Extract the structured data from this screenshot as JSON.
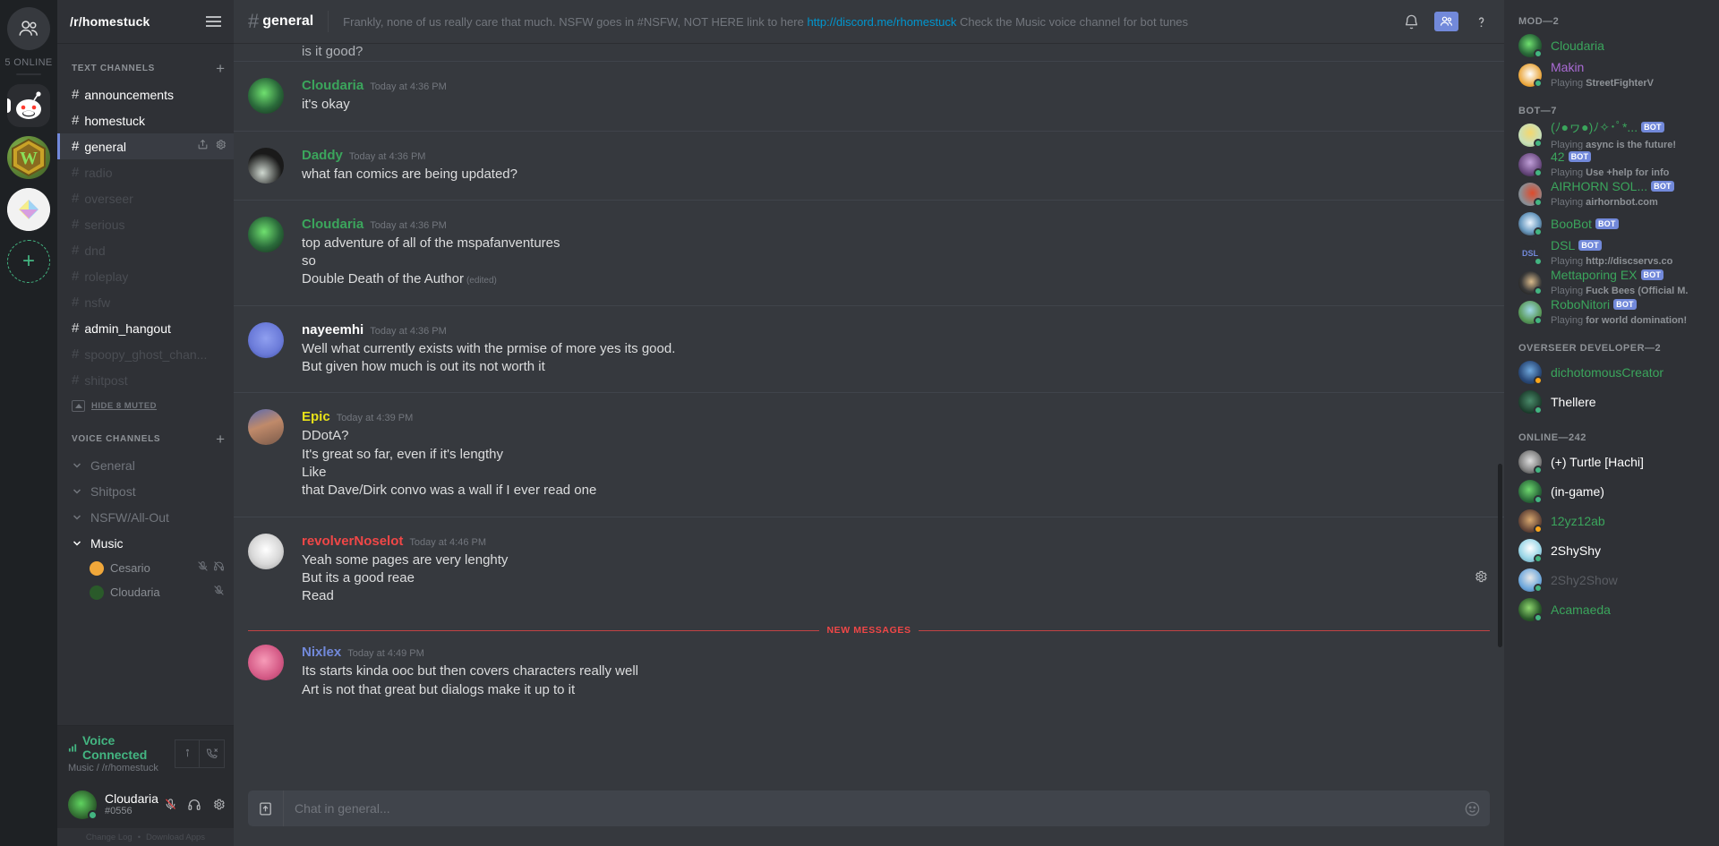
{
  "guild_rail": {
    "home_icon": "friends-icon",
    "online_label": "5 ONLINE",
    "add_label": "+",
    "servers": [
      {
        "name": "reddit-server",
        "colors": [
          "#2b2d31",
          "#ffffff"
        ]
      },
      {
        "name": "warcraft-server",
        "colors": [
          "#4a6b2a",
          "#c6e36a"
        ]
      },
      {
        "name": "pastel-server",
        "colors": [
          "#f0f0f0",
          "#f5e87a"
        ]
      }
    ]
  },
  "sidebar": {
    "guild_name": "/r/homestuck",
    "text_header": "TEXT CHANNELS",
    "voice_header": "VOICE CHANNELS",
    "add_channel": "+",
    "text_channels": [
      {
        "name": "announcements",
        "state": "unread"
      },
      {
        "name": "homestuck",
        "state": "unread"
      },
      {
        "name": "general",
        "state": "active"
      },
      {
        "name": "radio",
        "state": "muted"
      },
      {
        "name": "overseer",
        "state": "muted"
      },
      {
        "name": "serious",
        "state": "muted"
      },
      {
        "name": "dnd",
        "state": "muted"
      },
      {
        "name": "roleplay",
        "state": "muted"
      },
      {
        "name": "nsfw",
        "state": "muted"
      },
      {
        "name": "admin_hangout",
        "state": "unread"
      },
      {
        "name": "spoopy_ghost_chan...",
        "state": "muted"
      },
      {
        "name": "shitpost",
        "state": "muted"
      }
    ],
    "hide_muted_label": "HIDE 8 MUTED",
    "voice_channels": [
      {
        "name": "General",
        "selected": false,
        "users": []
      },
      {
        "name": "Shitpost",
        "selected": false,
        "users": []
      },
      {
        "name": "NSFW/All-Out",
        "selected": false,
        "users": []
      },
      {
        "name": "Music",
        "selected": true,
        "users": [
          {
            "name": "Cesario",
            "color": "#f0a73a"
          },
          {
            "name": "Cloudaria",
            "color": "#3a7a3a"
          }
        ]
      }
    ],
    "voice_panel": {
      "status": "Voice Connected",
      "location": "Music / /r/homestuck",
      "info_icon": "info-icon",
      "disconnect_icon": "phone-hangup-icon"
    },
    "user": {
      "name": "Cloudaria",
      "tag": "#0556",
      "mute_icon": "mic-muted-icon",
      "deafen_icon": "headphones-icon",
      "settings_icon": "gear-icon"
    },
    "footer": {
      "changelog": "Change Log",
      "separator": "•",
      "download": "Download Apps"
    }
  },
  "channel_header": {
    "hash": "#",
    "name": "general",
    "topic_pre": "Frankly, none of us really care that much. NSFW goes in #NSFW, NOT HERE link to here ",
    "topic_link": "http://discord.me/rhomestuck",
    "topic_post": " Check the Music voice channel for bot tunes",
    "bell_icon": "bell-icon",
    "members_icon": "members-icon",
    "help_icon": "help-icon"
  },
  "messages": {
    "partial_top": "is it good?",
    "new_messages_label": "NEW MESSAGES",
    "list": [
      {
        "user": "Cloudaria",
        "color": "#3ba55c",
        "time": "Today at 4:36 PM",
        "avatar": "cloudaria-avatar",
        "lines": [
          "it's okay"
        ]
      },
      {
        "user": "Daddy",
        "color": "#3ba55c",
        "time": "Today at 4:36 PM",
        "avatar": "daddy-avatar",
        "lines": [
          "what fan comics are being updated?"
        ]
      },
      {
        "user": "Cloudaria",
        "color": "#3ba55c",
        "time": "Today at 4:36 PM",
        "avatar": "cloudaria-avatar",
        "lines": [
          "top adventure of all of the mspafanventures",
          "so",
          "Double Death of the Author"
        ],
        "edited": "(edited)"
      },
      {
        "user": "nayeemhi",
        "color": "#ffffff",
        "time": "Today at 4:36 PM",
        "avatar": "nayeemhi-avatar",
        "lines": [
          "Well what currently exists with the prmise of more yes its good.",
          "But given how much is out its not worth it"
        ]
      },
      {
        "user": "Epic",
        "color": "#e7e119",
        "time": "Today at 4:39 PM",
        "avatar": "epic-avatar",
        "lines": [
          "DDotA?",
          "It's great so far, even if it's lengthy",
          "Like",
          "that Dave/Dirk convo was a wall if I ever read one"
        ]
      },
      {
        "user": "revolverNoselot",
        "color": "#f04747",
        "time": "Today at 4:46 PM",
        "avatar": "revolvernoselot-avatar",
        "lines": [
          "Yeah some pages are very lenghty",
          "But its a good reae",
          "Read"
        ],
        "gear": "gear-icon"
      },
      {
        "user": "Nixlex",
        "color": "#7289da",
        "time": "Today at 4:49 PM",
        "avatar": "nixlex-avatar",
        "lines": [
          "Its starts kinda ooc but then covers characters really well",
          "Art is not that great but dialogs make it up to it"
        ]
      }
    ]
  },
  "composer": {
    "upload_icon": "upload-icon",
    "placeholder": "Chat in general...",
    "emoji_icon": "emoji-icon"
  },
  "member_list": {
    "groups": [
      {
        "title": "MOD—2",
        "members": [
          {
            "name": "Cloudaria",
            "color": "#3ba55c",
            "status": "online",
            "game": "",
            "bot": false,
            "avatar_colors": [
              "#1f3a1f",
              "#5fd35f"
            ]
          },
          {
            "name": "Makin",
            "color": "#aa6bd4",
            "status": "online",
            "game_prefix": "Playing ",
            "game": "StreetFighterV",
            "bot": false,
            "avatar_colors": [
              "#e8a030",
              "#ffffff"
            ]
          }
        ]
      },
      {
        "title": "BOT—7",
        "members": [
          {
            "name": "(ﾉ●ヮ●)ﾉ✧･ﾟ*...",
            "color": "#3ba55c",
            "status": "online",
            "game_prefix": "Playing ",
            "game": "async is the future!",
            "bot": true,
            "avatar_colors": [
              "#c9e0b8",
              "#f5d76e"
            ]
          },
          {
            "name": "42",
            "color": "#3ba55c",
            "status": "online",
            "game_prefix": "Playing ",
            "game": "Use +help for info",
            "bot": true,
            "avatar_colors": [
              "#3a2a40",
              "#a06fc0"
            ]
          },
          {
            "name": "AIRHORN SOL...",
            "color": "#3ba55c",
            "status": "online",
            "game_prefix": "Playing ",
            "game": "airhornbot.com",
            "bot": true,
            "avatar_colors": [
              "#8a8f96",
              "#e04a2a"
            ]
          },
          {
            "name": "BooBot",
            "color": "#3ba55c",
            "status": "online",
            "game": "",
            "bot": true,
            "avatar_colors": [
              "#22242a",
              "#eaf4ff"
            ]
          },
          {
            "name": "DSL",
            "color": "#3ba55c",
            "status": "online",
            "game_prefix": "Playing ",
            "game": "http://discservs.co",
            "bot": true,
            "avatar_colors": [
              "#2f3136",
              "#7289da"
            ]
          },
          {
            "name": "Mettaporing EX",
            "color": "#3ba55c",
            "status": "online",
            "game_prefix": "Playing ",
            "game": "Fuck Bees (Official M.",
            "bot": true,
            "avatar_colors": [
              "#1a1a1a",
              "#d8b98a"
            ]
          },
          {
            "name": "RoboNitori",
            "color": "#3ba55c",
            "status": "online",
            "game_prefix": "Playing ",
            "game": "for world domination!",
            "bot": true,
            "avatar_colors": [
              "#5a9a5a",
              "#9fd8e8"
            ]
          }
        ]
      },
      {
        "title": "OVERSEER DEVELOPER—2",
        "members": [
          {
            "name": "dichotomousCreator",
            "color": "#3ba55c",
            "status": "idle",
            "game": "",
            "bot": false,
            "avatar_colors": [
              "#2a4a7a",
              "#6fa8dc"
            ]
          },
          {
            "name": "Thellere",
            "color": "#ffffff",
            "status": "online",
            "game": "",
            "bot": false,
            "avatar_colors": [
              "#1a3a2a",
              "#4a8a6a"
            ]
          }
        ]
      },
      {
        "title": "ONLINE—242",
        "members": [
          {
            "name": "(+) Turtle [Hachi]",
            "color": "#ffffff",
            "status": "online",
            "game": "",
            "bot": false,
            "avatar_colors": [
              "#2a2a2a",
              "#dddddd"
            ]
          },
          {
            "name": "(in-game)",
            "color": "#ffffff",
            "status": "online",
            "game": "",
            "bot": false,
            "avatar_colors": [
              "#1a3a1a",
              "#6fd86f"
            ]
          },
          {
            "name": "12yz12ab",
            "color": "#3ba55c",
            "status": "idle",
            "game": "",
            "bot": false,
            "avatar_colors": [
              "#3a2a2a",
              "#d8a86f"
            ]
          },
          {
            "name": "2ShyShy",
            "color": "#ffffff",
            "status": "online",
            "game": "",
            "bot": false,
            "avatar_colors": [
              "#9fd8e8",
              "#ffffff"
            ]
          },
          {
            "name": "2Shy2Show",
            "color": "#5a5d63",
            "status": "online",
            "game": "",
            "bot": false,
            "avatar_colors": [
              "#6fa8dc",
              "#e8e8e8"
            ]
          },
          {
            "name": "Acamaeda",
            "color": "#3ba55c",
            "status": "online",
            "game": "",
            "bot": false,
            "avatar_colors": [
              "#2a5a2a",
              "#8fd86f"
            ]
          }
        ]
      }
    ]
  }
}
